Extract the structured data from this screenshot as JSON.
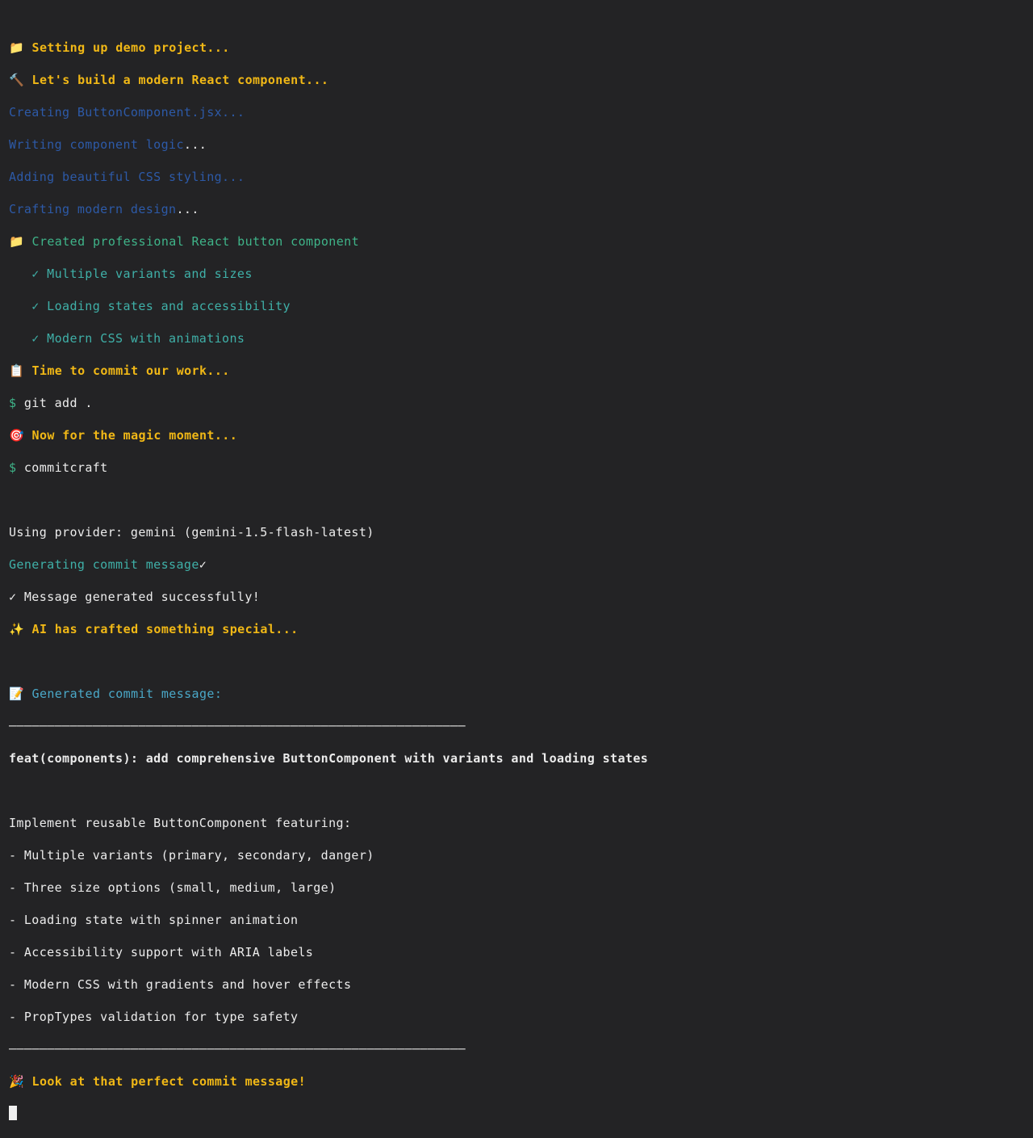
{
  "lines": {
    "l01": {
      "icon": "📁",
      "text": " Setting up demo project..."
    },
    "l02": {
      "icon": "🔨",
      "text": " Let's build a modern React component..."
    },
    "l03": {
      "a": "Creating ButtonComponent.jsx..."
    },
    "l04": {
      "a": "Writing component logic",
      "b": "..."
    },
    "l05": {
      "a": "Adding beautiful CSS styling..."
    },
    "l06": {
      "a": "Crafting modern design",
      "b": "..."
    },
    "l07": {
      "icon": "📁",
      "text": " Created professional React button component"
    },
    "l08": {
      "text": "   ✓ Multiple variants and sizes"
    },
    "l09": {
      "text": "   ✓ Loading states and accessibility"
    },
    "l10": {
      "text": "   ✓ Modern CSS with animations"
    },
    "l11": {
      "icon": "📋",
      "text": " Time to commit our work..."
    },
    "l12": {
      "prompt": "$",
      "text": " git add ."
    },
    "l13": {
      "icon": "🎯",
      "text": " Now for the magic moment..."
    },
    "l14": {
      "prompt": "$",
      "text": " commitcraft"
    },
    "l16": {
      "text": "Using provider: gemini (gemini-1.5-flash-latest)"
    },
    "l17": {
      "a": "Generating commit message",
      "b": "✓"
    },
    "l18": {
      "text": "✓ Message generated successfully!"
    },
    "l19": {
      "icon": "✨",
      "text": " AI has crafted something special..."
    },
    "l21": {
      "icon": "📝",
      "text": " Generated commit message:"
    },
    "l22": {
      "text": "────────────────────────────────────────────────────────────"
    },
    "l23": {
      "text": "feat(components): add comprehensive ButtonComponent with variants and loading states"
    },
    "l25": {
      "text": "Implement reusable ButtonComponent featuring:"
    },
    "l26": {
      "text": "- Multiple variants (primary, secondary, danger)"
    },
    "l27": {
      "text": "- Three size options (small, medium, large)"
    },
    "l28": {
      "text": "- Loading state with spinner animation"
    },
    "l29": {
      "text": "- Accessibility support with ARIA labels"
    },
    "l30": {
      "text": "- Modern CSS with gradients and hover effects"
    },
    "l31": {
      "text": "- PropTypes validation for type safety"
    },
    "l32": {
      "text": "────────────────────────────────────────────────────────────"
    },
    "l33": {
      "icon": "🎉",
      "text": " Look at that perfect commit message!"
    }
  }
}
